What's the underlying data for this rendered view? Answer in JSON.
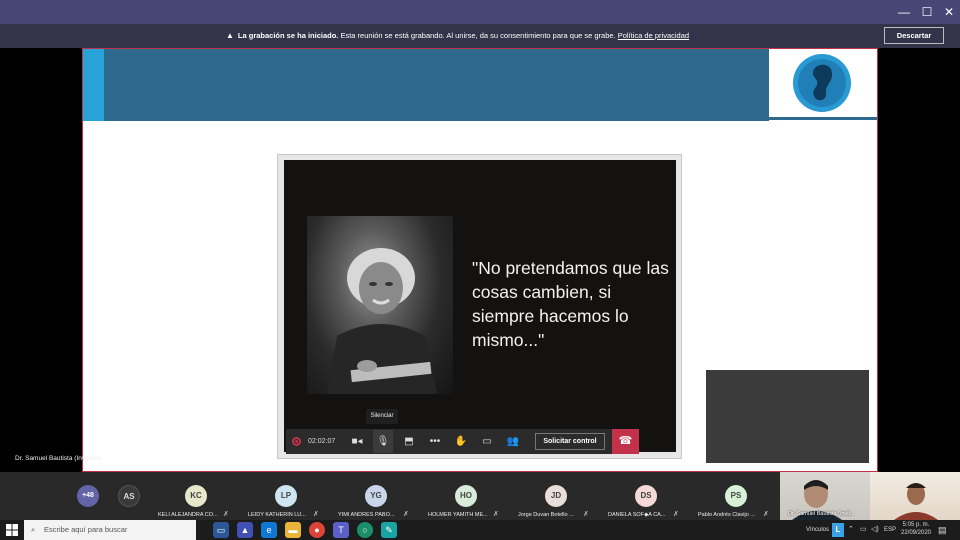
{
  "window": {
    "minimize_glyph": "—",
    "maximize_glyph": "☐",
    "close_glyph": "✕"
  },
  "banner": {
    "bold_text": "La grabación se ha iniciado.",
    "text": "Esta reunión se está grabando. Al unirse, da su consentimiento para que se grabe.",
    "link": "Política de privacidad",
    "dismiss_label": "Descartar"
  },
  "slide": {
    "quote": "\"No pretendamos que las cosas cambien, si siempre hacemos lo mismo...\""
  },
  "controls": {
    "timer": "02:02:07",
    "tooltip": "Silenciar",
    "request_control_label": "Solicitar control"
  },
  "presenter_label": "Dr. Samuel Bautista (Invitado)",
  "participants": {
    "more_count": "+48",
    "lone_initials": "AS",
    "items": [
      {
        "initials": "KC",
        "name": "KELI ALEJANDRA CO...",
        "color": "#e6e8c9"
      },
      {
        "initials": "LP",
        "name": "LEIDY KATHERIN LU...",
        "color": "#cde6f2"
      },
      {
        "initials": "YG",
        "name": "YIMI ANDRES PABO...",
        "color": "#c9d6ea"
      },
      {
        "initials": "HO",
        "name": "HOLMER YAMITH ME...",
        "color": "#d9ebd9"
      },
      {
        "initials": "JD",
        "name": "Jorge Duvan Botello ...",
        "color": "#e9dfd8"
      },
      {
        "initials": "DS",
        "name": "DANIELA SOF◆A CA...",
        "color": "#f5d8d8"
      },
      {
        "initials": "PS",
        "name": "Pablo Andrés Clavijo ...",
        "color": "#d8efd8"
      }
    ],
    "cam_label": "Dr. Samuel Bautista (Invit..."
  },
  "taskbar": {
    "search_placeholder": "Escribe aquí para buscar",
    "links_label": "Vínculos",
    "language": "ESP",
    "time": "5:05 p. m.",
    "date": "22/09/2020"
  }
}
